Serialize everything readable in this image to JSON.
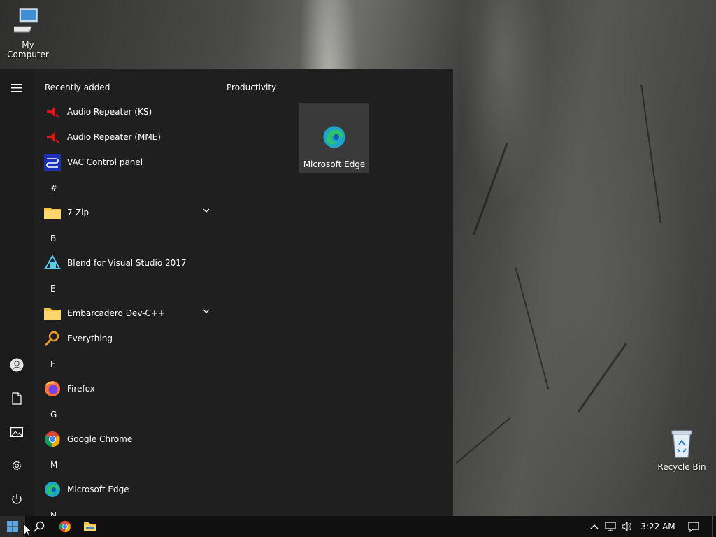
{
  "desktop": {
    "icons": [
      {
        "label": "My Computer"
      },
      {
        "label": "Recycle Bin"
      }
    ]
  },
  "start_menu": {
    "recently_added_label": "Recently added",
    "recent_items": [
      {
        "label": "Audio Repeater (KS)",
        "icon": "audio-repeater-icon"
      },
      {
        "label": "Audio Repeater (MME)",
        "icon": "audio-repeater-icon"
      },
      {
        "label": "VAC Control panel",
        "icon": "vac-icon"
      }
    ],
    "sections": [
      {
        "letter": "#"
      },
      {
        "letter": "B"
      },
      {
        "letter": "E"
      },
      {
        "letter": "F"
      },
      {
        "letter": "G"
      },
      {
        "letter": "M"
      },
      {
        "letter": "N"
      }
    ],
    "apps": [
      {
        "label": "7-Zip",
        "icon": "folder-icon"
      },
      {
        "label": "Blend for Visual Studio 2017",
        "icon": "blend-icon"
      },
      {
        "label": "Embarcadero Dev-C++",
        "icon": "folder-icon"
      },
      {
        "label": "Everything",
        "icon": "everything-icon"
      },
      {
        "label": "Firefox",
        "icon": "firefox-icon"
      },
      {
        "label": "Google Chrome",
        "icon": "chrome-icon"
      },
      {
        "label": "Microsoft Edge",
        "icon": "edge-icon"
      }
    ],
    "group_title": "Productivity",
    "tiles": [
      {
        "label": "Microsoft Edge",
        "icon": "edge-icon"
      }
    ]
  },
  "taskbar": {
    "clock": "3:22 AM"
  },
  "colors": {
    "start_bg": "#1f1f1f",
    "taskbar_bg": "#101010",
    "tile_bg": "#3a3a3a"
  }
}
